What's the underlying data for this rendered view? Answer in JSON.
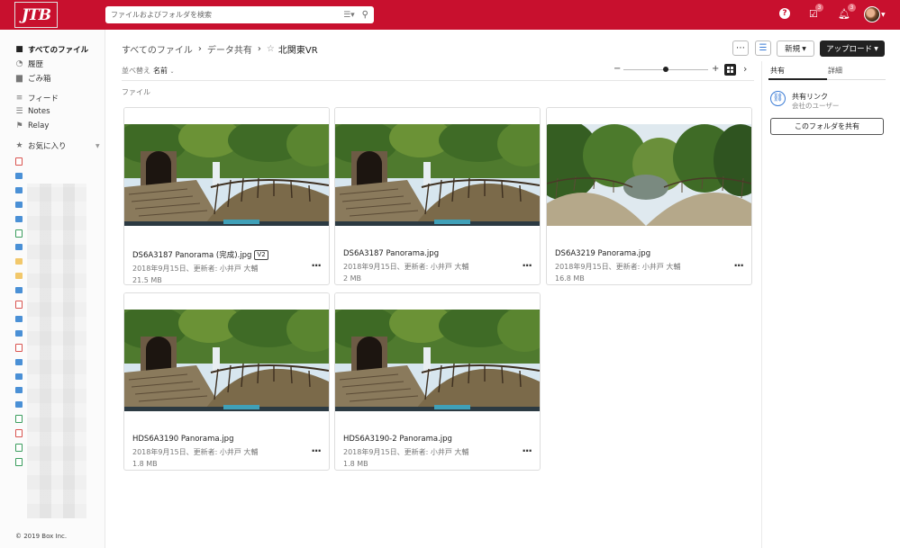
{
  "topbar": {
    "logo": "JTB",
    "search_placeholder": "ファイルおよびフォルダを検索",
    "tasks_badge": "3",
    "notifications_badge": "3",
    "help": "?"
  },
  "sidebar": {
    "items": [
      {
        "label": "すべてのファイル",
        "icon": "folder-icon"
      },
      {
        "label": "履歴",
        "icon": "clock-icon"
      },
      {
        "label": "ごみ箱",
        "icon": "trash-icon"
      },
      {
        "label": "フィード",
        "icon": "feed-icon"
      },
      {
        "label": "Notes",
        "icon": "notes-icon"
      },
      {
        "label": "Relay",
        "icon": "relay-icon"
      },
      {
        "label": "お気に入り",
        "icon": "star-icon"
      }
    ],
    "favorite_icons": [
      "pdf",
      "folder",
      "folder",
      "folder",
      "folder",
      "sheet",
      "folder",
      "yellow-folder",
      "yellow-folder",
      "folder",
      "pdf",
      "folder",
      "folder",
      "pdf",
      "folder",
      "folder",
      "folder",
      "folder",
      "sheet",
      "pdf",
      "sheet",
      "sheet"
    ],
    "copyright": "© 2019 Box Inc."
  },
  "breadcrumb": {
    "items": [
      "すべてのファイル",
      "データ共有"
    ],
    "current": "北関東VR"
  },
  "toolbar": {
    "new_label": "新規",
    "upload_label": "アップロード",
    "sort_label": "並べ替え",
    "sort_value": "名前"
  },
  "section_label": "ファイル",
  "files": [
    {
      "name": "DS6A3187 Panorama (完成).jpg",
      "version": "V2",
      "meta": "2018年9月15日、更新者: 小井戸 大輔",
      "size": "21.5 MB",
      "scene": "tunnel"
    },
    {
      "name": "DS6A3187 Panorama.jpg",
      "version": "",
      "meta": "2018年9月15日、更新者: 小井戸 大輔",
      "size": "2 MB",
      "scene": "tunnel"
    },
    {
      "name": "DS6A3219 Panorama.jpg",
      "version": "",
      "meta": "2018年9月15日、更新者: 小井戸 大輔",
      "size": "16.8 MB",
      "scene": "bridge"
    },
    {
      "name": "HDS6A3190 Panorama.jpg",
      "version": "",
      "meta": "2018年9月15日、更新者: 小井戸 大輔",
      "size": "1.8 MB",
      "scene": "tunnel"
    },
    {
      "name": "HDS6A3190-2 Panorama.jpg",
      "version": "",
      "meta": "2018年9月15日、更新者: 小井戸 大輔",
      "size": "1.8 MB",
      "scene": "tunnel"
    }
  ],
  "right_panel": {
    "tabs": [
      "共有",
      "詳細"
    ],
    "link_title": "共有リンク",
    "link_sub": "会社のユーザー",
    "share_button": "このフォルダを共有"
  },
  "colors": {
    "brand": "#c8102e",
    "link": "#3a7bd5",
    "primary_button": "#222222"
  }
}
